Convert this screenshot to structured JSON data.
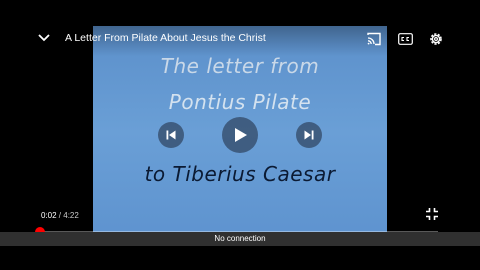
{
  "video": {
    "title": "A Letter From Pilate About Jesus the Christ",
    "slide_lines": [
      "The letter from",
      "Pontius Pilate",
      "to Tiberius Caesar"
    ],
    "current_time": "0:02",
    "separator": " / ",
    "duration": "4:22",
    "progress_fraction": 0.008
  },
  "icons": {
    "collapse": "chevron-down-icon",
    "cast": "cast-icon",
    "captions": "closed-captions-icon",
    "settings": "gear-icon",
    "previous": "skip-previous-icon",
    "play": "play-icon",
    "next": "skip-next-icon",
    "fullscreen": "exit-fullscreen-icon"
  },
  "status": {
    "message": "No connection"
  },
  "colors": {
    "accent": "#ff0000",
    "frame": "#6a9fd6",
    "status_bg": "#303030"
  }
}
